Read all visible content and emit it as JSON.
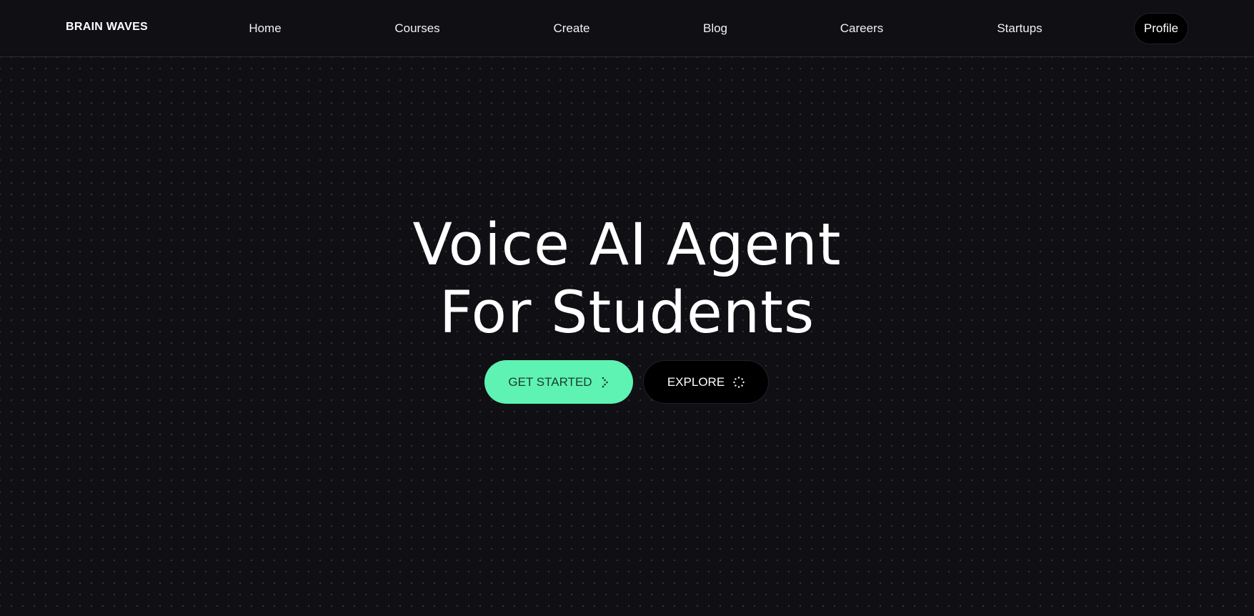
{
  "header": {
    "brand": "BRAIN WAVES",
    "nav": [
      {
        "label": "Home"
      },
      {
        "label": "Courses"
      },
      {
        "label": "Create"
      },
      {
        "label": "Blog"
      },
      {
        "label": "Careers"
      },
      {
        "label": "Startups"
      }
    ],
    "profile_label": "Profile"
  },
  "hero": {
    "title_line1": "Voice AI Agent",
    "title_line2": "For Students",
    "primary_button": {
      "label": "GET STARTED",
      "icon": "dotted-arrow-icon"
    },
    "secondary_button": {
      "label": "EXPLORE",
      "icon": "dotted-spinner-icon"
    }
  },
  "colors": {
    "background": "#0f0f14",
    "accent": "#5ef2b3",
    "button_dark": "#000000",
    "text": "#ffffff"
  }
}
